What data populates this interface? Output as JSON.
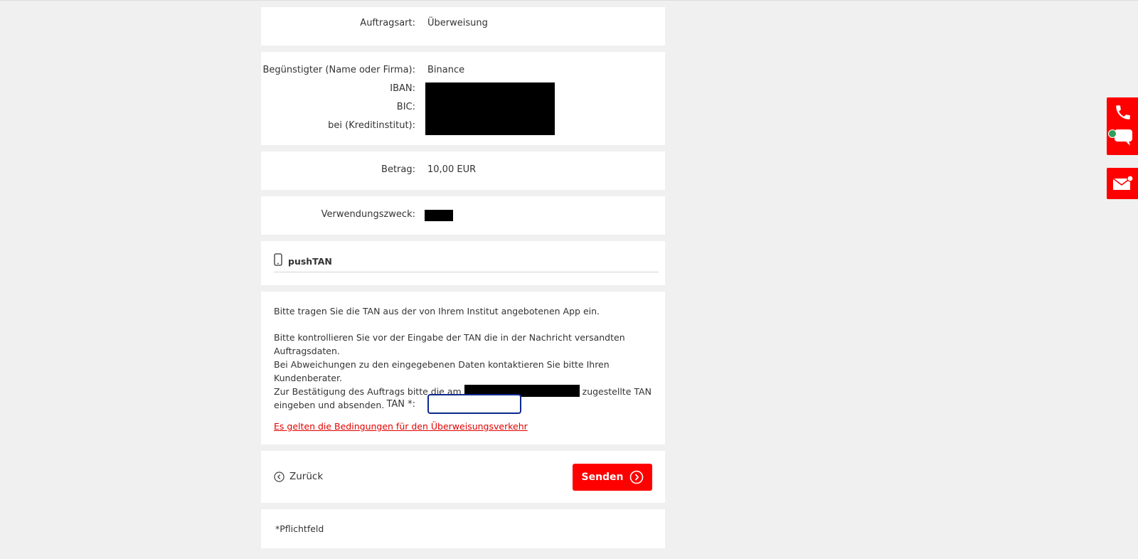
{
  "order_type": {
    "label": "Auftragsart:",
    "value": "Überweisung"
  },
  "beneficiary": {
    "name_label": "Begünstigter (Name oder Firma):",
    "name_value": "Binance",
    "iban_label": "IBAN:",
    "bic_label": "BIC:",
    "bank_label": "bei (Kreditinstitut):"
  },
  "amount": {
    "label": "Betrag:",
    "value": "10,00 EUR"
  },
  "purpose": {
    "label": "Verwendungszweck:"
  },
  "tan_method": {
    "label": "pushTAN",
    "icon": "smartphone-icon"
  },
  "instructions": {
    "p1": "Bitte tragen Sie die TAN aus der von Ihrem Institut angebotenen App ein.",
    "p2_line1": "Bitte kontrollieren Sie vor der Eingabe der TAN die in der Nachricht versandten Auftragsdaten.",
    "p2_line2": "Bei Abweichungen zu den eingegebenen Daten kontaktieren Sie bitte Ihren Kundenberater.",
    "p2_line3_pre": "Zur Bestätigung des Auftrags bitte die am",
    "p2_line3_post": "zugestellte TAN",
    "p2_line4": "eingeben und absenden."
  },
  "tan_field": {
    "label": "TAN *:",
    "value": ""
  },
  "terms_link": "Es gelten die Bedingungen für den Überweisungsverkehr",
  "actions": {
    "back_label": "Zurück",
    "send_label": "Senden"
  },
  "footer": {
    "required_note": "*Pflichtfeld"
  },
  "side_contact": {
    "phone_icon": "phone-icon",
    "chat_icon": "chat-icon",
    "mail_icon": "mail-icon"
  },
  "colors": {
    "accent": "#ff0000",
    "input_border": "#0b2a8f",
    "online_dot": "#2e9e5b"
  }
}
